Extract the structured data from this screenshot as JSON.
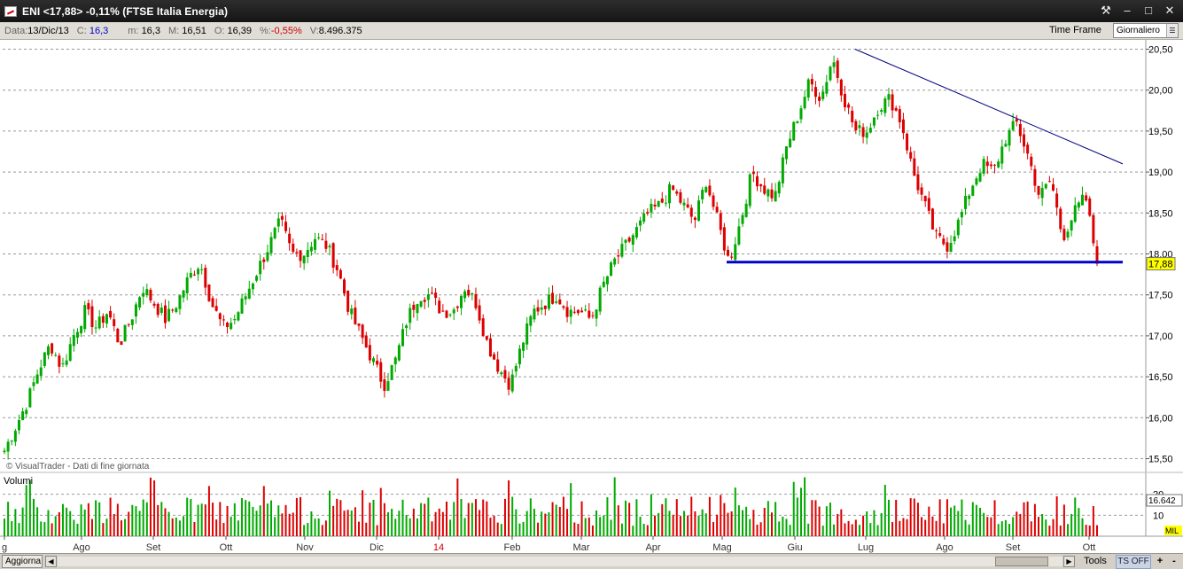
{
  "window": {
    "title": "ENI <17,88> -0,11%  (FTSE Italia Energia)",
    "controls": [
      "tools-icon",
      "minimize-icon",
      "maximize-icon",
      "close-icon"
    ]
  },
  "infobar": {
    "date_label": "Data:",
    "date_value": "13/Dic/13",
    "close_label": "C:",
    "close_value": "16,3",
    "min_label": "m:",
    "min_value": "16,3",
    "max_label": "M:",
    "max_value": "16,51",
    "open_label": "O:",
    "open_value": "16,39",
    "var_label": "%:",
    "var_value": "-0,55%",
    "vol_label": "V:",
    "vol_value": "8.496.375",
    "timeframe_label": "Time Frame",
    "timeframe_value": "Giornaliero"
  },
  "chart": {
    "credit": "© VisualTrader - Dati di fine giornata",
    "volume_title": "Volumi",
    "current_price_label": "17,88",
    "current_volume_label": "16.642",
    "volume_unit_label": "MIL",
    "colors": {
      "up": "#00aa00",
      "down": "#dd0000",
      "trendline": "#000080",
      "support": "#0000cc",
      "price_tag": "#ffff00"
    }
  },
  "chart_data": {
    "type": "candlestick",
    "y_axis": {
      "ticks": [
        "20,50",
        "20,00",
        "19,50",
        "19,00",
        "18,50",
        "18,00",
        "17,50",
        "17,00",
        "16,50",
        "16,00",
        "15,50"
      ],
      "range": [
        15.5,
        20.55
      ]
    },
    "volume_axis": {
      "ticks": [
        "20",
        "10"
      ],
      "unit": "MIL"
    },
    "x_axis": {
      "ticks": [
        "g",
        "Ago",
        "Set",
        "Ott",
        "Nov",
        "Dic",
        "14",
        "Feb",
        "Mar",
        "Apr",
        "Mag",
        "Giu",
        "Lug",
        "Ago",
        "Set",
        "Ott"
      ]
    },
    "last_price": 17.88,
    "trendlines": [
      {
        "type": "resistance",
        "from": {
          "date": "2014-06-30",
          "price": 20.5
        },
        "to": {
          "date": "2014-10-15",
          "price": 19.1
        }
      },
      {
        "type": "support",
        "price": 17.9,
        "from_date": "2014-05-01",
        "to_date": "2014-10-15"
      }
    ],
    "close_series_approx": [
      15.6,
      15.9,
      16.2,
      16.6,
      16.9,
      16.6,
      17.0,
      17.3,
      17.1,
      17.3,
      16.9,
      17.2,
      17.6,
      17.4,
      17.2,
      17.4,
      17.7,
      17.9,
      17.4,
      17.1,
      17.2,
      17.5,
      17.8,
      18.1,
      18.4,
      18.0,
      18.0,
      18.2,
      18.1,
      17.8,
      17.3,
      17.0,
      16.7,
      16.4,
      16.7,
      17.2,
      17.5,
      17.5,
      17.3,
      17.3,
      17.6,
      17.4,
      16.9,
      16.6,
      16.4,
      16.9,
      17.3,
      17.4,
      17.5,
      17.3,
      17.3,
      17.2,
      17.6,
      17.9,
      18.1,
      18.3,
      18.5,
      18.6,
      18.8,
      18.6,
      18.4,
      18.9,
      18.4,
      17.9,
      18.4,
      19.0,
      18.8,
      18.7,
      19.3,
      19.7,
      20.1,
      19.9,
      20.4,
      19.9,
      19.5,
      19.5,
      19.8,
      19.9,
      19.6,
      19.0,
      18.6,
      18.2,
      18.1,
      18.4,
      18.8,
      19.1,
      19.0,
      19.4,
      19.6,
      19.2,
      18.7,
      18.9,
      18.2,
      18.5,
      18.7,
      17.88
    ]
  },
  "statusbar": {
    "refresh_label": "Aggiorna",
    "tools_label": "Tools",
    "ts_label": "TS OFF",
    "zoom_in": "+",
    "zoom_out": "-"
  }
}
